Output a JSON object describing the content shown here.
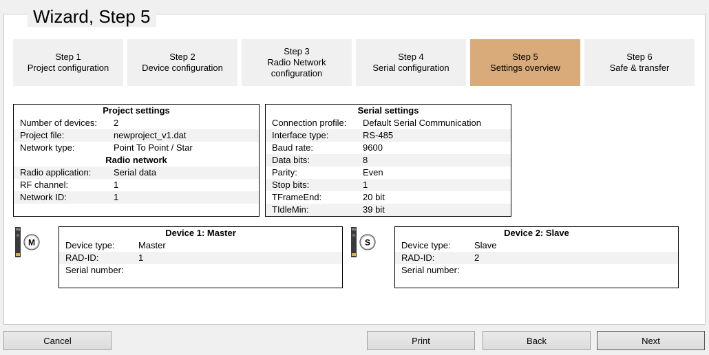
{
  "wizard": {
    "title": "Wizard, Step 5"
  },
  "steps": [
    {
      "line1": "Step 1",
      "line2": "Project configuration",
      "line3": ""
    },
    {
      "line1": "Step 2",
      "line2": "Device configuration",
      "line3": ""
    },
    {
      "line1": "Step 3",
      "line2": "Radio Network",
      "line3": "configuration"
    },
    {
      "line1": "Step 4",
      "line2": "Serial configuration",
      "line3": ""
    },
    {
      "line1": "Step 5",
      "line2": "Settings overview",
      "line3": ""
    },
    {
      "line1": "Step 6",
      "line2": "Safe & transfer",
      "line3": ""
    }
  ],
  "active_step": 5,
  "project_settings": {
    "title": "Project settings",
    "rows": [
      {
        "label": "Number of devices:",
        "value": "2"
      },
      {
        "label": "Project file:",
        "value": "newproject_v1.dat"
      },
      {
        "label": "Network type:",
        "value": "Point To Point / Star"
      }
    ],
    "radio_title": "Radio network",
    "radio_rows": [
      {
        "label": "Radio application:",
        "value": "Serial data"
      },
      {
        "label": "RF channel:",
        "value": "1"
      },
      {
        "label": "Network ID:",
        "value": "1"
      }
    ]
  },
  "serial_settings": {
    "title": "Serial settings",
    "rows": [
      {
        "label": "Connection profile:",
        "value": "Default Serial Communication"
      },
      {
        "label": "Interface type:",
        "value": "RS-485"
      },
      {
        "label": "Baud rate:",
        "value": "9600"
      },
      {
        "label": "Data bits:",
        "value": "8"
      },
      {
        "label": "Parity:",
        "value": "Even"
      },
      {
        "label": "Stop bits:",
        "value": "1"
      },
      {
        "label": "TFrameEnd:",
        "value": "20 bit"
      },
      {
        "label": "TIdleMin:",
        "value": "39 bit"
      }
    ]
  },
  "devices": [
    {
      "badge": "M",
      "title": "Device 1: Master",
      "rows": [
        {
          "label": "Device type:",
          "value": "Master"
        },
        {
          "label": "RAD-ID:",
          "value": "1"
        },
        {
          "label": "Serial number:",
          "value": ""
        }
      ]
    },
    {
      "badge": "S",
      "title": "Device 2: Slave",
      "rows": [
        {
          "label": "Device type:",
          "value": "Slave"
        },
        {
          "label": "RAD-ID:",
          "value": "2"
        },
        {
          "label": "Serial number:",
          "value": ""
        }
      ]
    }
  ],
  "buttons": {
    "cancel": "Cancel",
    "print": "Print",
    "back": "Back",
    "next": "Next"
  },
  "colors": {
    "active_step": "#d9ab7a",
    "step_bg": "#f0f0f0",
    "row_shade": "#f2f2f2"
  }
}
